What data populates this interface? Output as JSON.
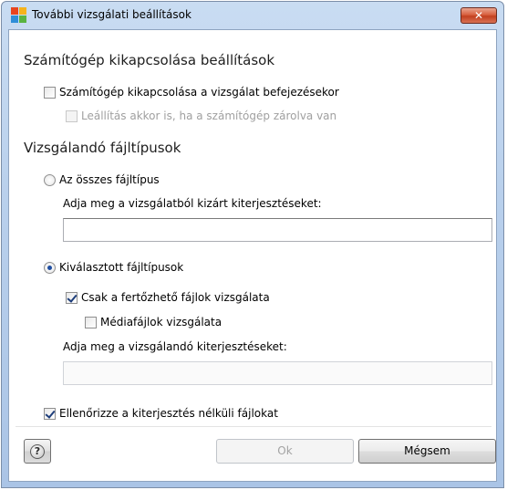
{
  "window": {
    "title": "További vizsgálati beállítások",
    "close_glyph": "✕",
    "app_icon": "avg-logo-icon"
  },
  "shutdown_section": {
    "title": "Számítógép kikapcsolása beállítások",
    "shutdown_checkbox": {
      "label": "Számítógép kikapcsolása a vizsgálat befejezésekor",
      "checked": false
    },
    "force_checkbox": {
      "label": "Leállítás akkor is, ha a számítógép zárolva van",
      "checked": false,
      "enabled": false
    }
  },
  "filetypes_section": {
    "title": "Vizsgálandó fájltípusok",
    "all_radio": {
      "label": "Az összes fájltípus",
      "selected": false
    },
    "excluded_label": "Adja meg a vizsgálatból kizárt kiterjesztéseket:",
    "excluded_value": "",
    "selected_radio": {
      "label": "Kiválasztott fájltípusok",
      "selected": true
    },
    "infectable_checkbox": {
      "label": "Csak a fertőzhető fájlok vizsgálata",
      "checked": true
    },
    "media_checkbox": {
      "label": "Médiafájlok vizsgálata",
      "checked": false
    },
    "included_label": "Adja meg a vizsgálandó kiterjesztéseket:",
    "included_value": "",
    "no_ext_checkbox": {
      "label": "Ellenőrizze a kiterjesztés nélküli fájlokat",
      "checked": true
    }
  },
  "footer": {
    "help_glyph": "?",
    "ok_label": "Ok",
    "cancel_label": "Mégsem"
  },
  "colors": {
    "titlebar": "#b9d0ec",
    "close_button": "#c2401f",
    "checkmark": "#1d3d7a"
  }
}
